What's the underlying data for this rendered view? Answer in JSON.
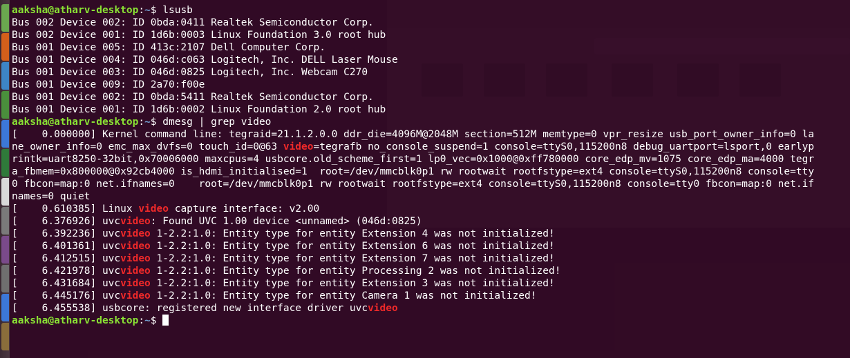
{
  "prompt": {
    "user": "aaksha@atharv-desktop",
    "sep": ":",
    "path": "~",
    "symbol": "$ "
  },
  "lines": [
    {
      "type": "prompt",
      "cmd": "lsusb"
    },
    {
      "type": "text",
      "text": "Bus 002 Device 002: ID 0bda:0411 Realtek Semiconductor Corp."
    },
    {
      "type": "text",
      "text": "Bus 002 Device 001: ID 1d6b:0003 Linux Foundation 3.0 root hub"
    },
    {
      "type": "text",
      "text": "Bus 001 Device 005: ID 413c:2107 Dell Computer Corp."
    },
    {
      "type": "text",
      "text": "Bus 001 Device 004: ID 046d:c063 Logitech, Inc. DELL Laser Mouse"
    },
    {
      "type": "text",
      "text": "Bus 001 Device 003: ID 046d:0825 Logitech, Inc. Webcam C270"
    },
    {
      "type": "text",
      "text": "Bus 001 Device 009: ID 2a70:f00e"
    },
    {
      "type": "text",
      "text": "Bus 001 Device 002: ID 0bda:5411 Realtek Semiconductor Corp."
    },
    {
      "type": "text",
      "text": "Bus 001 Device 001: ID 1d6b:0002 Linux Foundation 2.0 root hub"
    },
    {
      "type": "prompt",
      "cmd": "dmesg | grep video"
    },
    {
      "type": "seg",
      "parts": [
        {
          "t": "[    0.000000] Kernel command line: tegraid=21.1.2.0.0 ddr_die=4096M@2048M section=512M memtype=0 vpr_resize usb_port_owner_info=0 la"
        }
      ]
    },
    {
      "type": "seg",
      "parts": [
        {
          "t": "ne_owner_info=0 emc_max_dvfs=0 touch_id=0@63 "
        },
        {
          "t": "video",
          "hl": true
        },
        {
          "t": "=tegrafb no_console_suspend=1 console=ttyS0,115200n8 debug_uartport=lsport,0 earlyp"
        }
      ]
    },
    {
      "type": "seg",
      "parts": [
        {
          "t": "rintk=uart8250-32bit,0x70006000 maxcpus=4 usbcore.old_scheme_first=1 lp0_vec=0x1000@0xff780000 core_edp_mv=1075 core_edp_ma=4000 tegr"
        }
      ]
    },
    {
      "type": "seg",
      "parts": [
        {
          "t": "a_fbmem=0x800000@0x92cb4000 is_hdmi_initialised=1  root=/dev/mmcblk0p1 rw rootwait rootfstype=ext4 console=ttyS0,115200n8 console=tty"
        }
      ]
    },
    {
      "type": "seg",
      "parts": [
        {
          "t": "0 fbcon=map:0 net.ifnames=0    root=/dev/mmcblk0p1 rw rootwait rootfstype=ext4 console=ttyS0,115200n8 console=tty0 fbcon=map:0 net.if"
        }
      ]
    },
    {
      "type": "seg",
      "parts": [
        {
          "t": "names=0 quiet"
        }
      ]
    },
    {
      "type": "seg",
      "parts": [
        {
          "t": "[    0.610385] Linux "
        },
        {
          "t": "video",
          "hl": true
        },
        {
          "t": " capture interface: v2.00"
        }
      ]
    },
    {
      "type": "seg",
      "parts": [
        {
          "t": "[    6.376926] uvc"
        },
        {
          "t": "video",
          "hl": true
        },
        {
          "t": ": Found UVC 1.00 device <unnamed> (046d:0825)"
        }
      ]
    },
    {
      "type": "seg",
      "parts": [
        {
          "t": "[    6.392236] uvc"
        },
        {
          "t": "video",
          "hl": true
        },
        {
          "t": " 1-2.2:1.0: Entity type for entity Extension 4 was not initialized!"
        }
      ]
    },
    {
      "type": "seg",
      "parts": [
        {
          "t": "[    6.401361] uvc"
        },
        {
          "t": "video",
          "hl": true
        },
        {
          "t": " 1-2.2:1.0: Entity type for entity Extension 6 was not initialized!"
        }
      ]
    },
    {
      "type": "seg",
      "parts": [
        {
          "t": "[    6.412515] uvc"
        },
        {
          "t": "video",
          "hl": true
        },
        {
          "t": " 1-2.2:1.0: Entity type for entity Extension 7 was not initialized!"
        }
      ]
    },
    {
      "type": "seg",
      "parts": [
        {
          "t": "[    6.421978] uvc"
        },
        {
          "t": "video",
          "hl": true
        },
        {
          "t": " 1-2.2:1.0: Entity type for entity Processing 2 was not initialized!"
        }
      ]
    },
    {
      "type": "seg",
      "parts": [
        {
          "t": "[    6.431684] uvc"
        },
        {
          "t": "video",
          "hl": true
        },
        {
          "t": " 1-2.2:1.0: Entity type for entity Extension 3 was not initialized!"
        }
      ]
    },
    {
      "type": "seg",
      "parts": [
        {
          "t": "[    6.445176] uvc"
        },
        {
          "t": "video",
          "hl": true
        },
        {
          "t": " 1-2.2:1.0: Entity type for entity Camera 1 was not initialized!"
        }
      ]
    },
    {
      "type": "seg",
      "parts": [
        {
          "t": "[    6.455538] usbcore: registered new interface driver uvc"
        },
        {
          "t": "video",
          "hl": true
        }
      ]
    },
    {
      "type": "prompt",
      "cmd": "",
      "cursor": true
    }
  ],
  "colors": {
    "terminal_bg": "#300a24",
    "prompt_user": "#8ae234",
    "prompt_path": "#729fcf",
    "grep_match": "#ef2929",
    "text": "#ffffff"
  },
  "launcher": {
    "icons": [
      "launcher-app-icon",
      "launcher-app-icon",
      "launcher-app-icon",
      "launcher-app-icon",
      "launcher-app-icon",
      "launcher-app-icon",
      "launcher-app-icon",
      "launcher-app-icon",
      "launcher-app-icon",
      "launcher-app-icon",
      "launcher-app-icon",
      "launcher-app-icon"
    ],
    "icon_colors": [
      "#6aa84f",
      "#d35f1b",
      "#3d85c6",
      "#4a8f3c",
      "#3c78d8",
      "#2f7a3a",
      "#d9d9d9",
      "#7a7a7a",
      "#7a4a8a",
      "#6f6f6f",
      "#3c78d8",
      "#8a6d3b"
    ]
  }
}
